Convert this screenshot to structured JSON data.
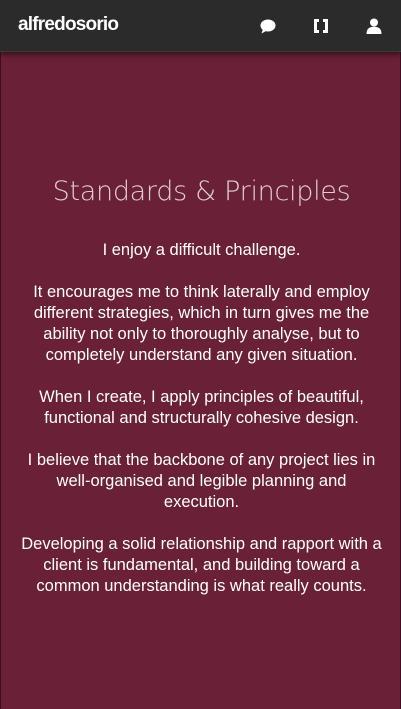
{
  "navbar": {
    "brand": "alfredosorio",
    "icons": [
      "chat-icon",
      "code-brackets-icon",
      "user-icon"
    ]
  },
  "main": {
    "title": "Standards & Principles",
    "paragraphs": [
      "I enjoy a difficult challenge.",
      "It encourages me to think laterally and employ different strategies, which in turn gives me the ability not only to thoroughly analyse, but to completely understand any given situation.",
      "When I create, I apply principles of beautiful, functional and structurally cohesive design.",
      "I believe that the backbone of any project lies in well-organised and legible planning and execution.",
      "Developing a solid relationship and rapport with a client is fundamental, and building toward a common understanding is what really counts."
    ]
  },
  "colors": {
    "navbar_background": "#2b2b2b",
    "content_background": "#6a2137",
    "text": "#ffffff"
  }
}
